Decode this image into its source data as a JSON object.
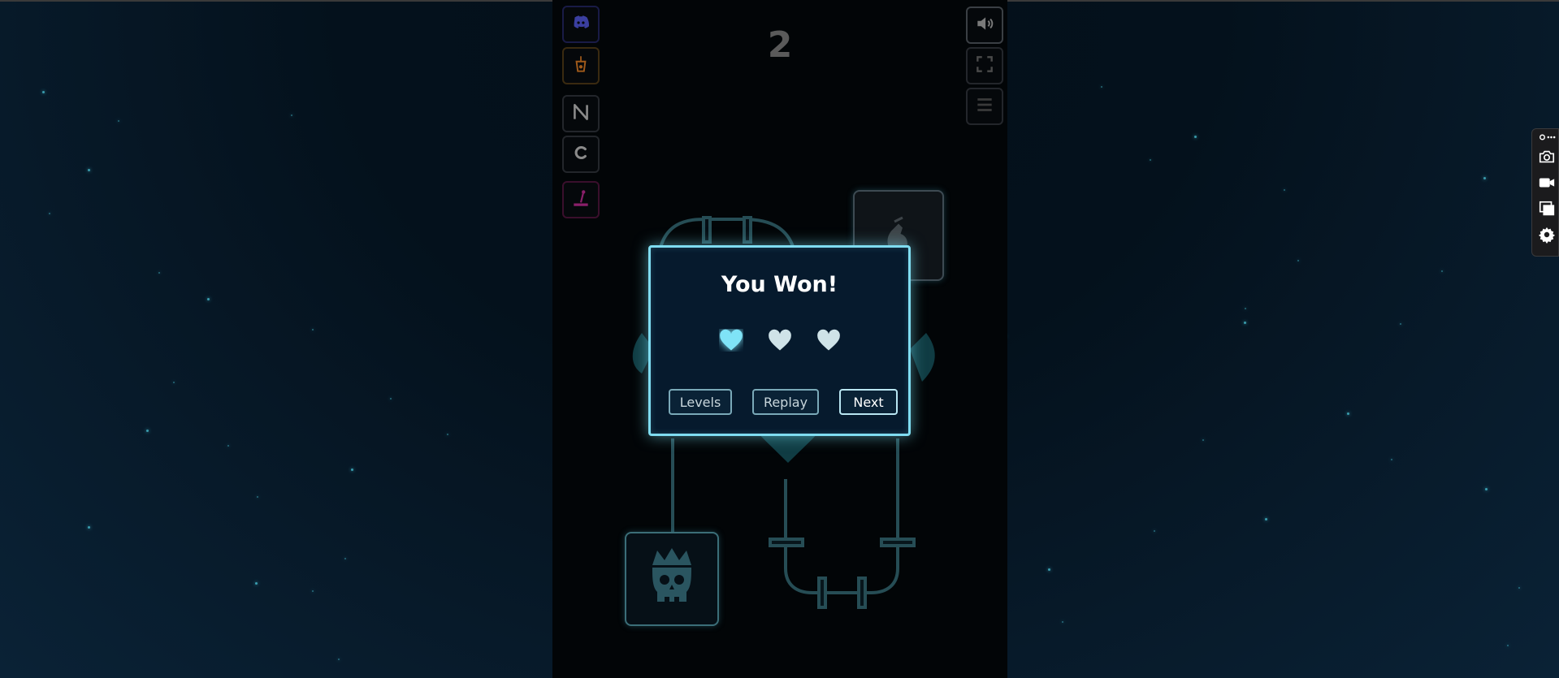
{
  "game": {
    "score": "2",
    "left_buttons": [
      {
        "name": "discord-button",
        "icon": "discord-icon",
        "color": "#3b3fa0"
      },
      {
        "name": "drink-button",
        "icon": "cup-icon",
        "color": "#a05a1a"
      },
      {
        "name": "near-button",
        "icon": "near-logo-icon",
        "color": "#8a8a8a"
      },
      {
        "name": "c-button",
        "icon": "c-logo-icon",
        "color": "#8a8a8a"
      },
      {
        "name": "joystick-button",
        "icon": "joystick-icon",
        "color": "#8a1f6a"
      }
    ],
    "right_buttons": [
      {
        "name": "sound-button",
        "icon": "speaker-icon"
      },
      {
        "name": "fullscreen-button",
        "icon": "fullscreen-icon"
      },
      {
        "name": "menu-button",
        "icon": "hamburger-icon"
      }
    ],
    "dialog": {
      "title": "You Won!",
      "hearts_earned": 1,
      "hearts_total": 3,
      "heart_active_color": "#7fe3f7",
      "heart_inactive_color": "#cfe3e8",
      "levels_label": "Levels",
      "replay_label": "Replay",
      "next_label": "Next"
    }
  },
  "browser_toolbar": {
    "icons": [
      "link-more-icon",
      "camera-icon",
      "video-icon",
      "window-icon",
      "gear-icon"
    ]
  }
}
